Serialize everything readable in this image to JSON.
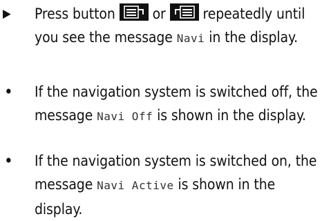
{
  "step": {
    "marker": "▶",
    "t1": "Press button",
    "button1_icon": "display-button-left-icon",
    "t2": "or",
    "button2_icon": "display-button-right-icon",
    "t3": "repeatedly until you see the message",
    "msg": "Navi",
    "t4": "in the display."
  },
  "bullets": [
    {
      "marker": "•",
      "t1": "If the navigation system is switched off, the message",
      "msg": "Navi Off",
      "t2": "is shown in the display."
    },
    {
      "marker": "•",
      "t1": "If the navigation system is switched on, the message",
      "msg": "Navi Active",
      "t2": "is shown in the display."
    }
  ]
}
